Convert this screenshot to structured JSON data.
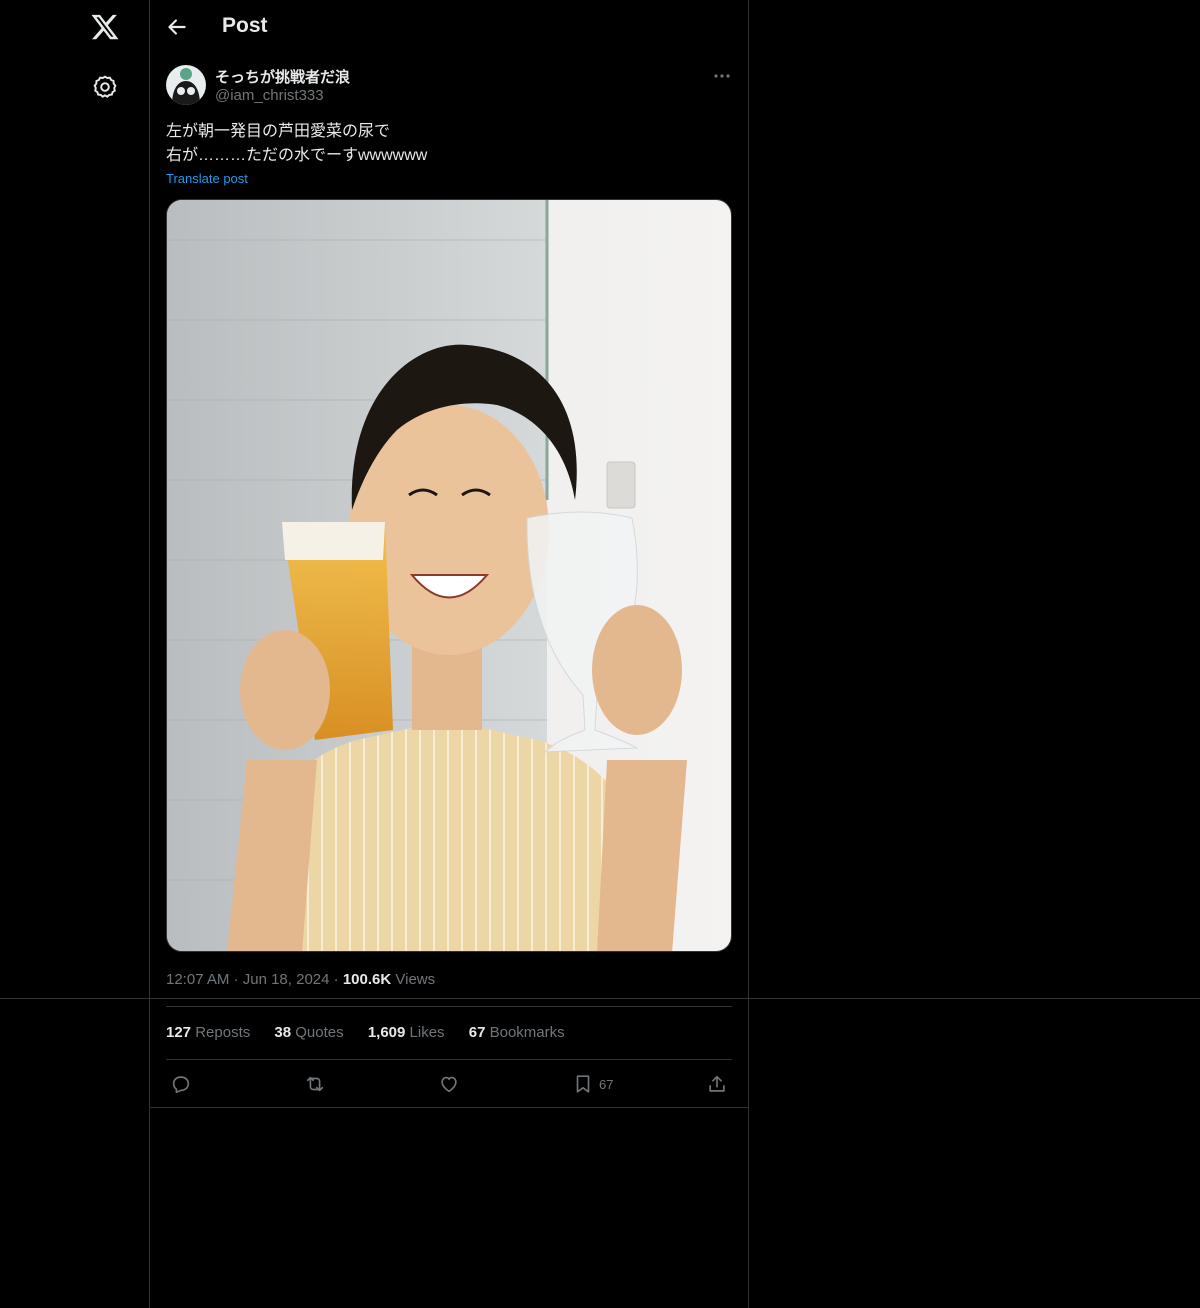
{
  "header": {
    "title": "Post"
  },
  "post": {
    "display_name": "そっちが挑戦者だ浪",
    "handle": "@iam_christ333",
    "text_line1": "左が朝一発目の芦田愛菜の尿で",
    "text_line2": "右が………ただの水でーすwwwwww",
    "translate_label": "Translate post",
    "time": "12:07 AM",
    "date": "Jun 18, 2024",
    "views_count": "100.6K",
    "views_label": "Views"
  },
  "stats": {
    "reposts_count": "127",
    "reposts_label": "Reposts",
    "quotes_count": "38",
    "quotes_label": "Quotes",
    "likes_count": "1,609",
    "likes_label": "Likes",
    "bookmarks_count": "67",
    "bookmarks_label": "Bookmarks"
  },
  "actions": {
    "bookmark_count": "67"
  },
  "icons": [
    "x-logo-icon",
    "settings-icon",
    "back-arrow-icon",
    "more-icon",
    "reply-icon",
    "repost-icon",
    "like-icon",
    "bookmark-icon",
    "share-icon"
  ],
  "colors": {
    "background": "#000000",
    "text": "#e7e9ea",
    "muted": "#71767b",
    "link": "#1d9bf0",
    "border": "#2f3336"
  }
}
